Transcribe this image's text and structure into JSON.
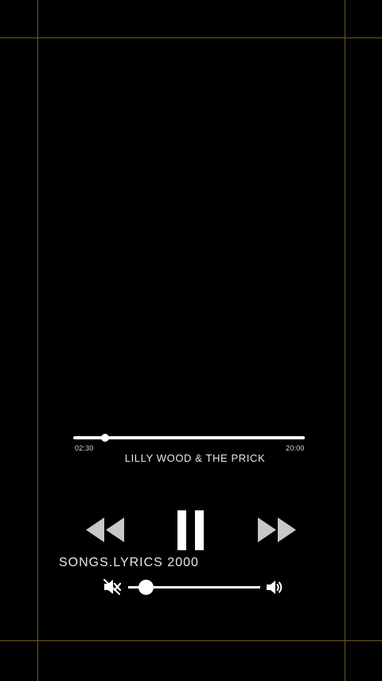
{
  "player": {
    "time_elapsed": "02:30",
    "time_total": "20:00",
    "progress_fraction": 0.138,
    "artist": "LILLY WOOD & THE PRICK",
    "channel_name": "SONGS.LYRICS 2000",
    "volume_fraction": 0.13,
    "icons": {
      "rewind": "rewind-icon",
      "pause": "pause-icon",
      "fast_forward": "fast-forward-icon",
      "mute": "volume-mute-icon",
      "volume": "volume-up-icon"
    },
    "colors": {
      "background": "#000000",
      "foreground": "#ffffff",
      "buttons": "#c8c8c8",
      "guides": "#6b5a22"
    }
  }
}
